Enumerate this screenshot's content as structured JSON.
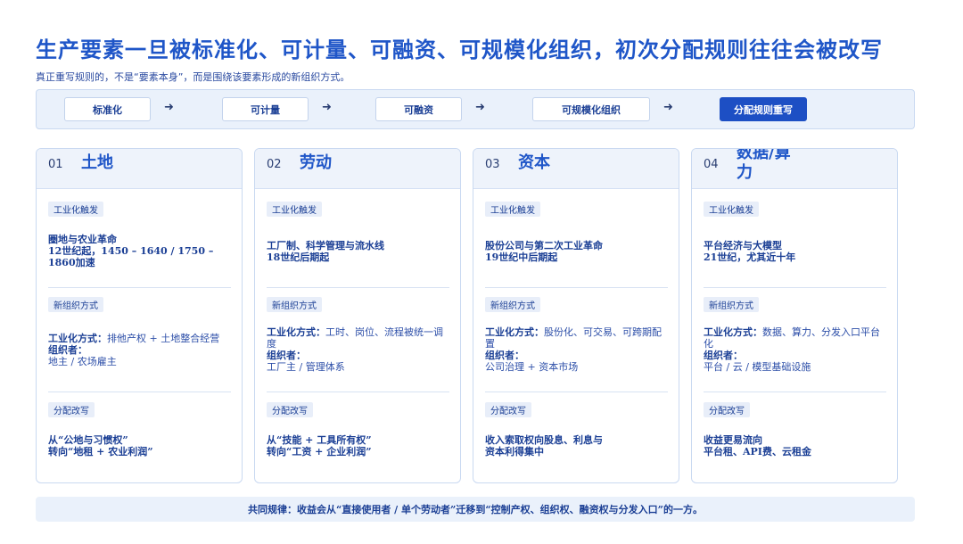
{
  "header": {
    "title": "生产要素一旦被标准化、可计量、可融资、可规模化组织，初次分配规则往往会被改写",
    "subtitle": "真正重写规则的，不是“要素本身”，而是围绕该要素形成的新组织方式。"
  },
  "flow": {
    "steps": [
      "标准化",
      "可计量",
      "可融资",
      "可规模化组织",
      "分配规则重写"
    ],
    "arrow": "➜"
  },
  "labels": {
    "trigger": "工业化触发",
    "new_org": "新组织方式",
    "redistribution": "分配改写",
    "industrial_way": "工业化方式：",
    "organizer": "组织者："
  },
  "cards": [
    {
      "num": "01",
      "title": "土地",
      "trigger_title": "圈地与农业革命",
      "trigger_detail": "12世纪起，1450 – 1640 / 1750 – 1860加速",
      "industrial_way": "排他产权 + 土地整合经营",
      "organizer": "地主 / 农场雇主",
      "redistribution_1": "从“公地与习惯权”",
      "redistribution_2": "转向“地租 + 农业利润”"
    },
    {
      "num": "02",
      "title": "劳动",
      "trigger_title": "工厂制、科学管理与流水线",
      "trigger_detail": "18世纪后期起",
      "industrial_way": "工时、岗位、流程被统一调度",
      "organizer": "工厂主 / 管理体系",
      "redistribution_1": "从“技能 + 工具所有权”",
      "redistribution_2": "转向“工资 + 企业利润”"
    },
    {
      "num": "03",
      "title": "资本",
      "trigger_title": "股份公司与第二次工业革命",
      "trigger_detail": "19世纪中后期起",
      "industrial_way": "股份化、可交易、可跨期配置",
      "organizer": "公司治理 + 资本市场",
      "redistribution_1": "收入索取权向股息、利息与",
      "redistribution_2": "资本利得集中"
    },
    {
      "num": "04",
      "title": "数据/算力",
      "trigger_title": "平台经济与大模型",
      "trigger_detail": "21世纪，尤其近十年",
      "industrial_way": "数据、算力、分发入口平台化",
      "organizer": "平台 / 云 / 模型基础设施",
      "redistribution_1": "收益更易流向",
      "redistribution_2": "平台租、API费、云租金"
    }
  ],
  "footer": {
    "text": "共同规律：收益会从“直接使用者 / 单个劳动者”迁移到“控制产权、组织权、融资权与分发入口”的一方。"
  }
}
